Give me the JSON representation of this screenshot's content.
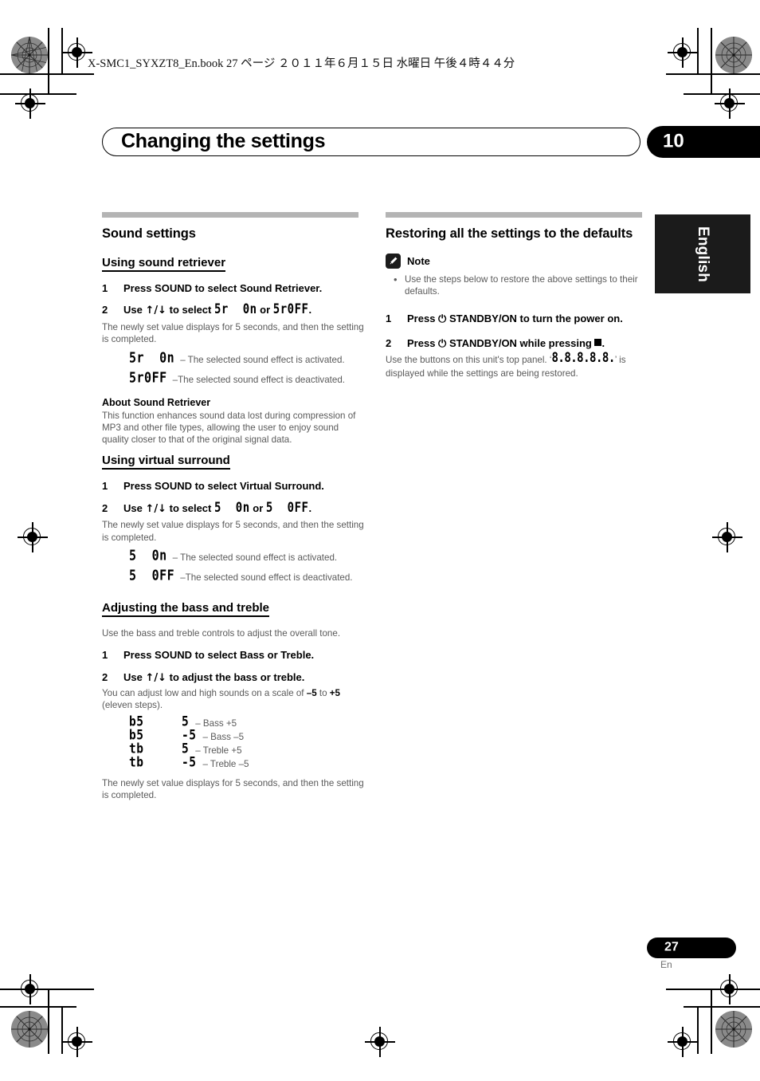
{
  "header": {
    "book_line": "X-SMC1_SYXZT8_En.book    27 ページ    ２０１１年６月１５日    水曜日    午後４時４４分"
  },
  "chapter": {
    "title": "Changing the settings",
    "number": "10"
  },
  "side_tab": {
    "language": "English"
  },
  "footer": {
    "page_number": "27",
    "page_lang": "En"
  },
  "left_column": {
    "section_heading": "Sound settings",
    "sub1": {
      "heading": "Using sound retriever",
      "step1_num": "1",
      "step1_text": "Press SOUND to select Sound Retriever.",
      "step2_num": "2",
      "step2_prefix": "Use ",
      "step2_arrows": "↑/↓",
      "step2_mid": " to select ",
      "step2_lcd_a": "5r  0n",
      "step2_or": " or ",
      "step2_lcd_b": "5r0FF",
      "step2_end": ".",
      "note": "The newly set value displays for 5 seconds, and then the setting is completed.",
      "def1_lcd": "5r  0n",
      "def1_desc": "– The selected sound effect is activated.",
      "def2_lcd": "5r0FF",
      "def2_desc": "–The selected sound effect is deactivated."
    },
    "about": {
      "heading": "About Sound Retriever",
      "body": "This function enhances sound data lost during compression of MP3 and other file types, allowing the user to enjoy sound quality closer to that of the original signal data."
    },
    "sub2": {
      "heading": "Using virtual surround",
      "step1_num": "1",
      "step1_text": "Press SOUND to select Virtual Surround.",
      "step2_num": "2",
      "step2_prefix": "Use ",
      "step2_arrows": "↑/↓",
      "step2_mid": " to select ",
      "step2_lcd_a": "5  0n",
      "step2_or": " or ",
      "step2_lcd_b": "5  0FF",
      "step2_end": ".",
      "note": "The newly set value displays for 5 seconds, and then the setting is completed.",
      "def1_lcd": "5  0n",
      "def1_desc": "– The selected sound effect is activated.",
      "def2_lcd": "5  0FF",
      "def2_desc": "–The selected sound effect is deactivated."
    },
    "sub3": {
      "heading": "Adjusting the bass and treble",
      "intro": "Use the bass and treble controls to adjust the overall tone.",
      "step1_num": "1",
      "step1_text": "Press SOUND to select Bass or Treble.",
      "step2_num": "2",
      "step2_prefix": "Use ",
      "step2_arrows": "↑/↓",
      "step2_mid": " to adjust the bass or treble.",
      "scale_pre": "You can adjust low and high sounds on a scale of ",
      "scale_min": "–5",
      "scale_mid": " to ",
      "scale_max": "+5",
      "scale_post": " (eleven steps).",
      "values": [
        {
          "lcd": "b5",
          "val": "5",
          "desc": "– Bass +5"
        },
        {
          "lcd": "b5",
          "val": "-5",
          "desc": "– Bass –5"
        },
        {
          "lcd": "tb",
          "val": "5",
          "desc": "– Treble +5"
        },
        {
          "lcd": "tb",
          "val": "-5",
          "desc": "– Treble –5"
        }
      ],
      "closing": "The newly set value displays for 5 seconds, and then the setting is completed."
    }
  },
  "right_column": {
    "section_heading": "Restoring all the settings to the defaults",
    "note_label": "Note",
    "note_bullet": "•",
    "note_text": "Use the steps below to restore the above settings to their defaults.",
    "step1_num": "1",
    "step1_pre": "Press ",
    "step1_power": "⏻",
    "step1_text": " STANDBY/ON to turn the power on.",
    "step2_num": "2",
    "step2_pre": "Press ",
    "step2_power": "⏻",
    "step2_text": " STANDBY/ON while pressing ",
    "step2_end": ".",
    "body_pre": "Use the buttons on this unit's top panel. ‘",
    "body_lcd": "8.8.8.8.8.",
    "body_post": "’ is displayed while the settings are being restored."
  },
  "colors": {
    "rule_gray": "#b4b4b4",
    "body_gray": "#5a5a5a",
    "black": "#000000",
    "tab_black": "#1b1b1b"
  }
}
